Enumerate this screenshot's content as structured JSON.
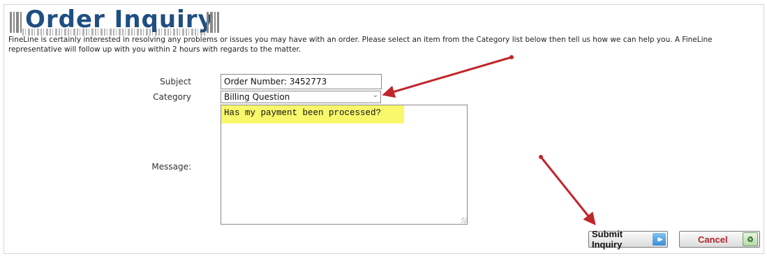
{
  "header": {
    "title": "Order Inquiry",
    "intro": "FineLine is certainly interested in resolving any problems or issues you may have with an order. Please select an item from the Category list below then tell us how we can help you. A FineLine representative will follow up with you within 2 hours with regards to the matter."
  },
  "form": {
    "subject_label": "Subject",
    "subject_value": "Order Number: 3452773",
    "category_label": "Category",
    "category_value": "Billing Question",
    "message_label": "Message:",
    "message_value": "Has my payment been processed?"
  },
  "buttons": {
    "submit_label": "Submit Inquiry",
    "cancel_label": "Cancel"
  },
  "colors": {
    "title": "#1f4e82",
    "annotation_arrow": "#c0262b",
    "highlight": "#f9f76b",
    "cancel_text": "#b2222d"
  },
  "icons": {
    "submit": "double-chevron-right-icon",
    "cancel": "recycle-icon",
    "category": "chevron-down-icon",
    "brand": "barcode-icon"
  }
}
